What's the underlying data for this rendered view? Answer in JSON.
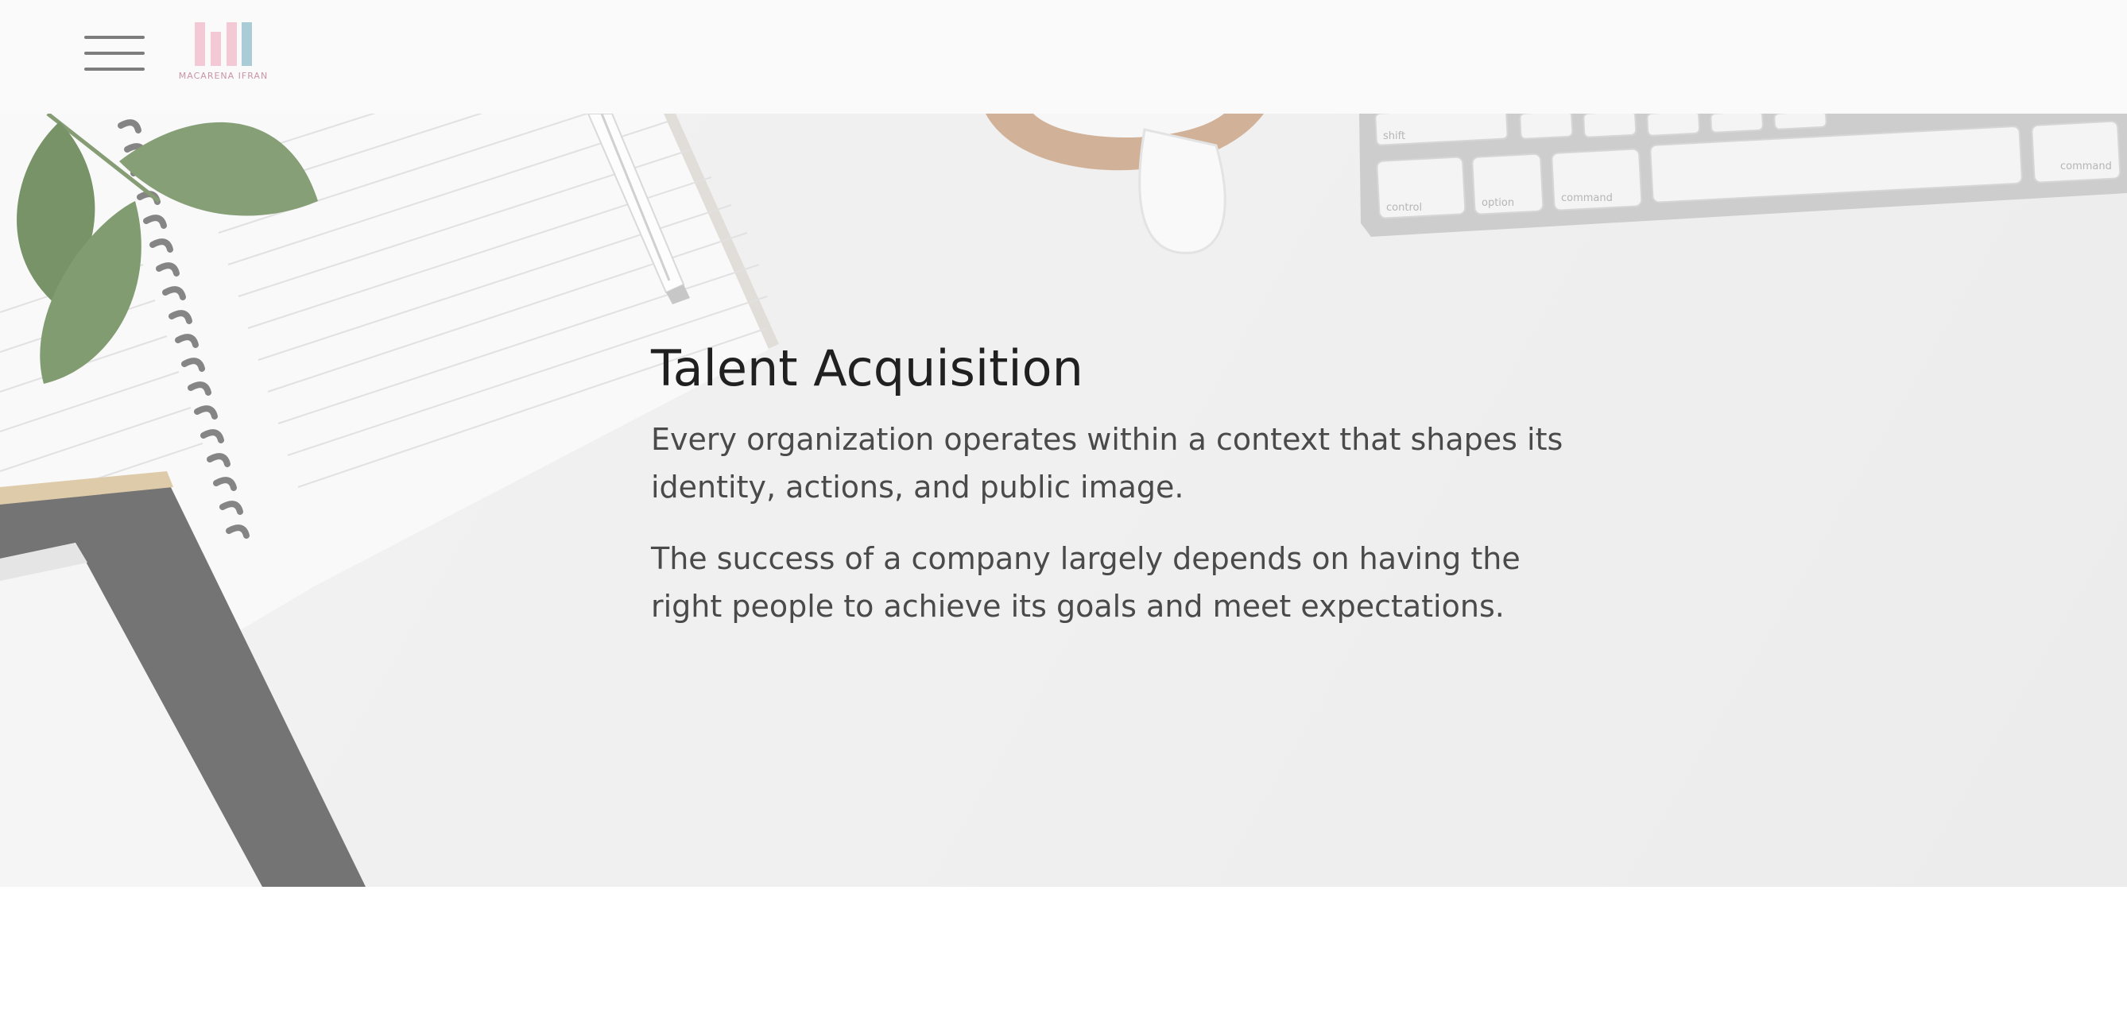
{
  "header": {
    "menu_icon": "hamburger-menu-icon",
    "logo_icon": "bar-logo-icon",
    "logo_text": "MACARENA IFRAN",
    "logo_colors": [
      "#f2c9d5",
      "#f2c9d5",
      "#f2c9d5",
      "#a9ccd6"
    ]
  },
  "hero": {
    "title": "Talent Acquisition",
    "paragraphs": [
      "Every organization operates within a context that shapes its identity, actions, and public image.",
      "The success of a company largely depends on having the right people to achieve its goals and meet expectations."
    ]
  }
}
